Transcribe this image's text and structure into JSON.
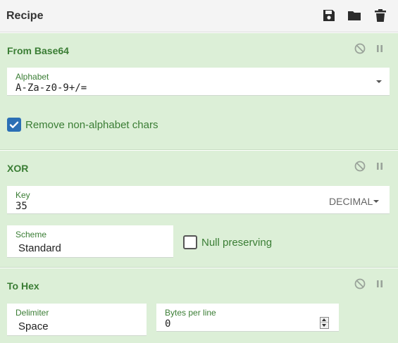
{
  "header": {
    "title": "Recipe",
    "icons": [
      "save-icon",
      "folder-icon",
      "trash-icon"
    ]
  },
  "operations": [
    {
      "title": "From Base64",
      "alphabet": {
        "label": "Alphabet",
        "value": "A-Za-z0-9+/="
      },
      "remove_non_alphabet": {
        "label": "Remove non-alphabet chars",
        "checked": true
      }
    },
    {
      "title": "XOR",
      "key": {
        "label": "Key",
        "value": "35",
        "format": "DECIMAL"
      },
      "scheme": {
        "label": "Scheme",
        "value": "Standard"
      },
      "null_preserving": {
        "label": "Null preserving",
        "checked": false
      }
    },
    {
      "title": "To Hex",
      "delimiter": {
        "label": "Delimiter",
        "value": "Space"
      },
      "bytes_per_line": {
        "label": "Bytes per line",
        "value": "0"
      }
    }
  ],
  "op_icons": [
    "disable-icon",
    "pause-icon"
  ],
  "colors": {
    "op_background": "#dcefd7",
    "op_title": "#3a7d34",
    "checkbox_checked": "#2b6fb5"
  }
}
